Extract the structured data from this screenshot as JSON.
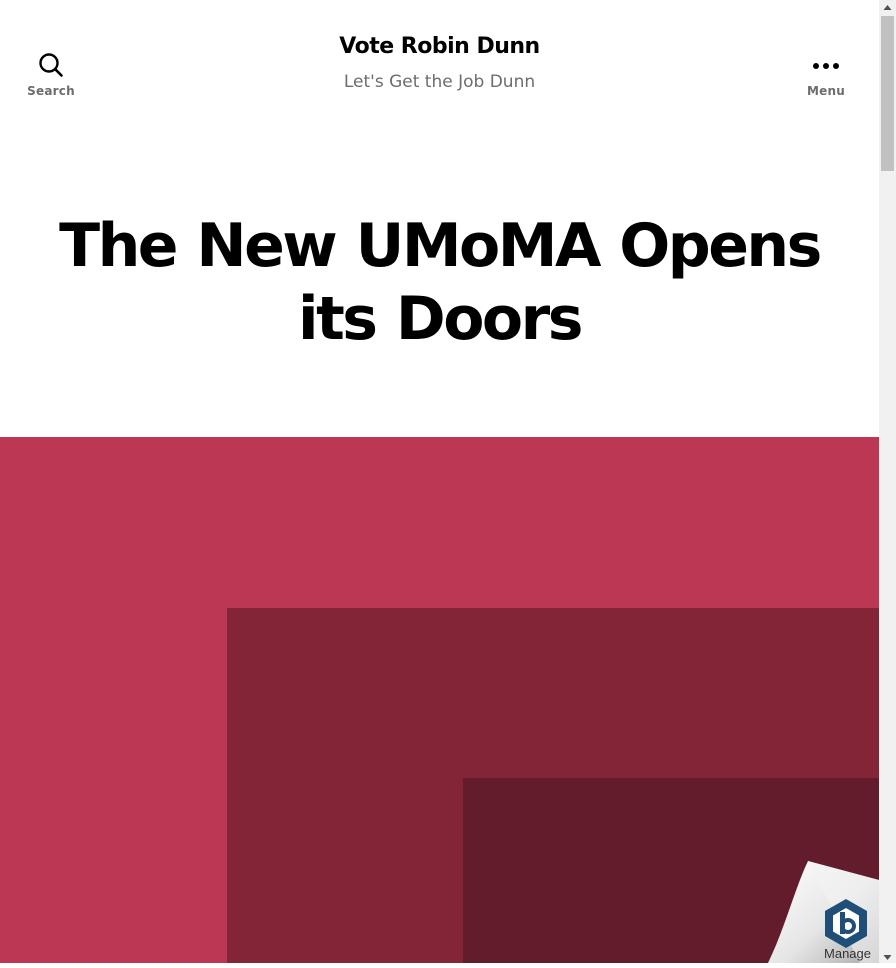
{
  "header": {
    "site_title": "Vote Robin Dunn",
    "site_description": "Let's Get the Job Dunn",
    "search_label": "Search",
    "menu_label": "Menu",
    "search_icon": "search-icon",
    "menu_icon": "ellipsis-icon"
  },
  "post": {
    "title": "The New UMoMA Opens its Doors"
  },
  "featured_image": {
    "colors": {
      "outer": "#bb3753",
      "middle": "#842437",
      "inner": "#621c2c"
    }
  },
  "manage_widget": {
    "label": "Manage",
    "icon": "hexagon-logo-icon"
  },
  "colors": {
    "text": "#000000",
    "muted": "#6d6d6d",
    "accent": "#bb3753"
  }
}
